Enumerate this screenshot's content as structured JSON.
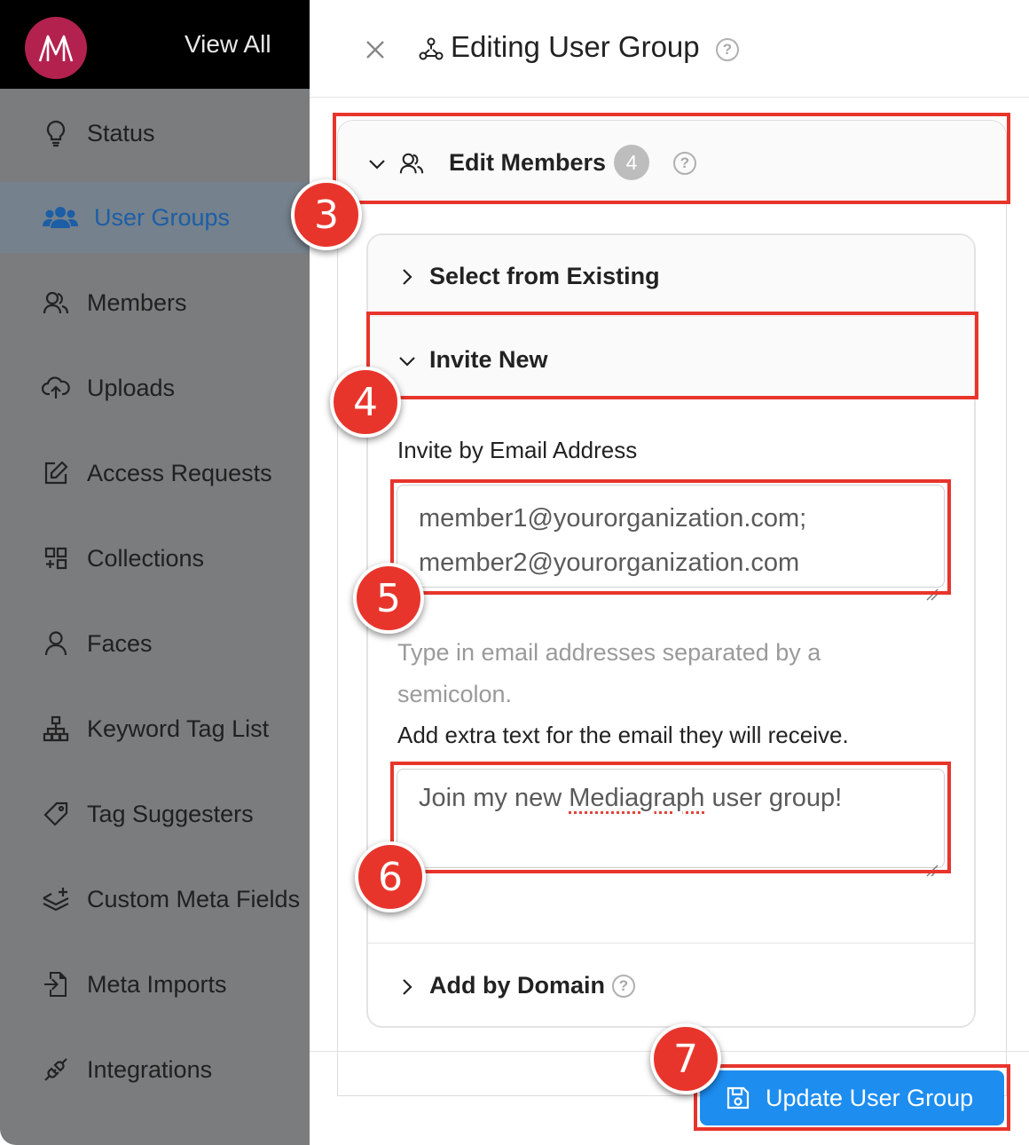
{
  "sidebar": {
    "view_all": "View All",
    "items": [
      {
        "label": "Status",
        "icon": "lightbulb-icon"
      },
      {
        "label": "User Groups",
        "icon": "users-icon",
        "active": true
      },
      {
        "label": "Members",
        "icon": "members-icon"
      },
      {
        "label": "Uploads",
        "icon": "cloud-upload-icon"
      },
      {
        "label": "Access Requests",
        "icon": "edit-square-icon"
      },
      {
        "label": "Collections",
        "icon": "collections-icon"
      },
      {
        "label": "Faces",
        "icon": "person-icon"
      },
      {
        "label": "Keyword Tag List",
        "icon": "hierarchy-icon"
      },
      {
        "label": "Tag Suggesters",
        "icon": "tag-icon"
      },
      {
        "label": "Custom Meta Fields",
        "icon": "layers-plus-icon"
      },
      {
        "label": "Meta Imports",
        "icon": "file-import-icon"
      },
      {
        "label": "Integrations",
        "icon": "plug-icon"
      }
    ]
  },
  "header": {
    "title": "Editing User Group"
  },
  "edit_members": {
    "label": "Edit Members",
    "count": "4"
  },
  "sections": {
    "select_existing": "Select from Existing",
    "invite_new": "Invite New",
    "add_by_domain": "Add by Domain"
  },
  "invite": {
    "email_label": "Invite by Email Address",
    "email_line1": "member1@yourorganization.com;",
    "email_line2": "member2@yourorganization.com",
    "hint": "Type in email addresses separated by a semicolon.",
    "extra_label": "Add extra text for the email they will receive.",
    "extra_before": "Join my new ",
    "extra_spell": "Mediagraph",
    "extra_after": " user group!"
  },
  "footer": {
    "update_label": "Update User Group"
  },
  "steps": [
    "3",
    "4",
    "5",
    "6",
    "7"
  ],
  "colors": {
    "accent": "#1d8df0",
    "annotation": "#e8352c",
    "active_nav": "#1c5ea6",
    "logo": "#b3224f"
  }
}
